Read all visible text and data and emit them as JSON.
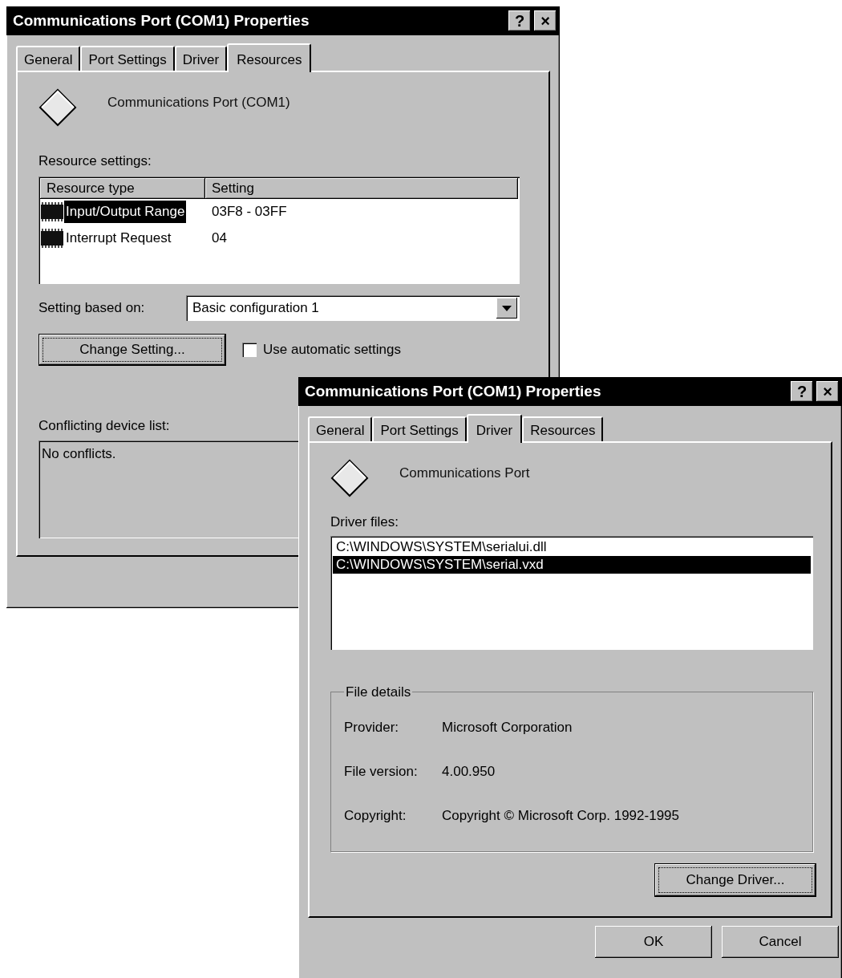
{
  "windows": [
    {
      "kind": "resources",
      "title": "Communications Port (COM1) Properties",
      "title_buttons": [
        "?",
        "×"
      ],
      "tabs": [
        {
          "label": "General",
          "selected": false
        },
        {
          "label": "Port Settings",
          "selected": false
        },
        {
          "label": "Driver",
          "selected": false
        },
        {
          "label": "Resources",
          "selected": true
        }
      ],
      "device_name": "Communications Port (COM1)",
      "resource_settings": {
        "label": "Resource settings:",
        "columns": [
          "Resource type",
          "Setting"
        ],
        "rows": [
          {
            "type": "Input/Output Range",
            "setting": "03F8 - 03FF",
            "selected": true
          },
          {
            "type": "Interrupt Request",
            "setting": "04",
            "selected": false
          }
        ]
      },
      "setting_based_on": {
        "label": "Setting based on:",
        "value": "Basic configuration 1"
      },
      "change_button": "Change Setting...",
      "automatic_settings": {
        "label": "Use automatic settings",
        "checked": false
      },
      "conflicts": {
        "label": "Conflicting device list:",
        "text": "No conflicts."
      }
    },
    {
      "kind": "driver",
      "title": "Communications Port (COM1) Properties",
      "title_buttons": [
        "?",
        "×"
      ],
      "tabs": [
        {
          "label": "General",
          "selected": false
        },
        {
          "label": "Port Settings",
          "selected": false
        },
        {
          "label": "Driver",
          "selected": true
        },
        {
          "label": "Resources",
          "selected": false
        }
      ],
      "device_name": "Communications Port",
      "driver_files": {
        "label": "Driver files:",
        "files": [
          {
            "path": "C:\\WINDOWS\\SYSTEM\\serialui.dll",
            "selected": false
          },
          {
            "path": "C:\\WINDOWS\\SYSTEM\\serial.vxd",
            "selected": true
          }
        ]
      },
      "file_details": {
        "label": "File details",
        "rows": [
          {
            "label": "Provider:",
            "value": "Microsoft Corporation"
          },
          {
            "label": "File version:",
            "value": "4.00.950"
          },
          {
            "label": "Copyright:",
            "value": "Copyright © Microsoft Corp. 1992-1995"
          }
        ]
      },
      "change_button": "Change Driver...",
      "buttons": [
        "OK",
        "Cancel"
      ]
    }
  ]
}
